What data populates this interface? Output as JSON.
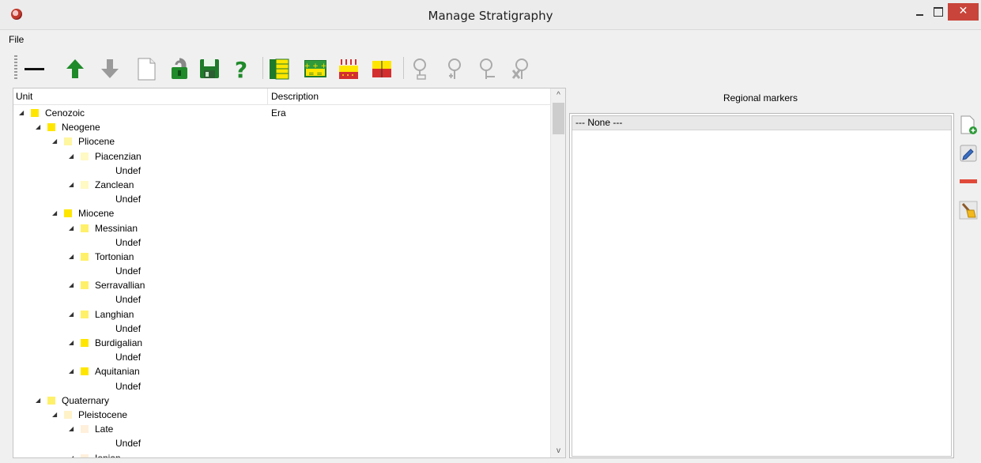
{
  "window": {
    "title": "Manage Stratigraphy",
    "close_glyph": "✕"
  },
  "menu": {
    "file_label": "File"
  },
  "toolbar": {
    "buttons": [
      {
        "icon": "line-icon"
      },
      {
        "icon": "arrow-up-icon"
      },
      {
        "icon": "arrow-down-icon"
      },
      {
        "icon": "new-document-icon"
      },
      {
        "icon": "unlock-icon"
      },
      {
        "icon": "save-icon"
      },
      {
        "icon": "help-icon"
      },
      {
        "icon": "color-column-icon"
      },
      {
        "icon": "layer-symbols-icon"
      },
      {
        "icon": "pattern-layers-icon"
      },
      {
        "icon": "split-layer-icon"
      },
      {
        "icon": "marker-icon"
      },
      {
        "icon": "marker-add-icon"
      },
      {
        "icon": "marker-remove-icon"
      },
      {
        "icon": "marker-delete-icon"
      }
    ]
  },
  "tree": {
    "columns": {
      "unit": "Unit",
      "description": "Description"
    },
    "rows": [
      {
        "label": "Cenozoic",
        "description": "Era",
        "level": 0,
        "expanded": true,
        "swatch": "#ffe600"
      },
      {
        "label": "Neogene",
        "description": "",
        "level": 1,
        "expanded": true,
        "swatch": "#ffe600"
      },
      {
        "label": "Pliocene",
        "description": "",
        "level": 2,
        "expanded": true,
        "swatch": "#fff6a0"
      },
      {
        "label": "Piacenzian",
        "description": "",
        "level": 3,
        "expanded": true,
        "swatch": "#fff9c4"
      },
      {
        "label": "Undef",
        "description": "",
        "level": 4,
        "expanded": false,
        "swatch": ""
      },
      {
        "label": "Zanclean",
        "description": "",
        "level": 3,
        "expanded": true,
        "swatch": "#fff9c4"
      },
      {
        "label": "Undef",
        "description": "",
        "level": 4,
        "expanded": false,
        "swatch": ""
      },
      {
        "label": "Miocene",
        "description": "",
        "level": 2,
        "expanded": true,
        "swatch": "#ffe600"
      },
      {
        "label": "Messinian",
        "description": "",
        "level": 3,
        "expanded": true,
        "swatch": "#fff06a"
      },
      {
        "label": "Undef",
        "description": "",
        "level": 4,
        "expanded": false,
        "swatch": ""
      },
      {
        "label": "Tortonian",
        "description": "",
        "level": 3,
        "expanded": true,
        "swatch": "#fff06a"
      },
      {
        "label": "Undef",
        "description": "",
        "level": 4,
        "expanded": false,
        "swatch": ""
      },
      {
        "label": "Serravallian",
        "description": "",
        "level": 3,
        "expanded": true,
        "swatch": "#fff06a"
      },
      {
        "label": "Undef",
        "description": "",
        "level": 4,
        "expanded": false,
        "swatch": ""
      },
      {
        "label": "Langhian",
        "description": "",
        "level": 3,
        "expanded": true,
        "swatch": "#fff06a"
      },
      {
        "label": "Undef",
        "description": "",
        "level": 4,
        "expanded": false,
        "swatch": ""
      },
      {
        "label": "Burdigalian",
        "description": "",
        "level": 3,
        "expanded": true,
        "swatch": "#ffe600"
      },
      {
        "label": "Undef",
        "description": "",
        "level": 4,
        "expanded": false,
        "swatch": ""
      },
      {
        "label": "Aquitanian",
        "description": "",
        "level": 3,
        "expanded": true,
        "swatch": "#ffe600"
      },
      {
        "label": "Undef",
        "description": "",
        "level": 4,
        "expanded": false,
        "swatch": ""
      },
      {
        "label": "Quaternary",
        "description": "",
        "level": 1,
        "expanded": true,
        "swatch": "#fff06a"
      },
      {
        "label": "Pleistocene",
        "description": "",
        "level": 2,
        "expanded": true,
        "swatch": "#fff2c8"
      },
      {
        "label": "Late",
        "description": "",
        "level": 3,
        "expanded": true,
        "swatch": "#fff0dc"
      },
      {
        "label": "Undef",
        "description": "",
        "level": 4,
        "expanded": false,
        "swatch": ""
      },
      {
        "label": "Ionian",
        "description": "",
        "level": 3,
        "expanded": true,
        "swatch": "#fff0dc"
      }
    ],
    "scroll_up_glyph": "^",
    "scroll_down_glyph": "v"
  },
  "markers": {
    "title": "Regional markers",
    "items": [
      "--- None ---"
    ],
    "side_buttons": [
      {
        "icon": "add-marker-icon"
      },
      {
        "icon": "edit-marker-icon"
      },
      {
        "icon": "remove-marker-icon"
      },
      {
        "icon": "clear-markers-icon"
      }
    ]
  }
}
